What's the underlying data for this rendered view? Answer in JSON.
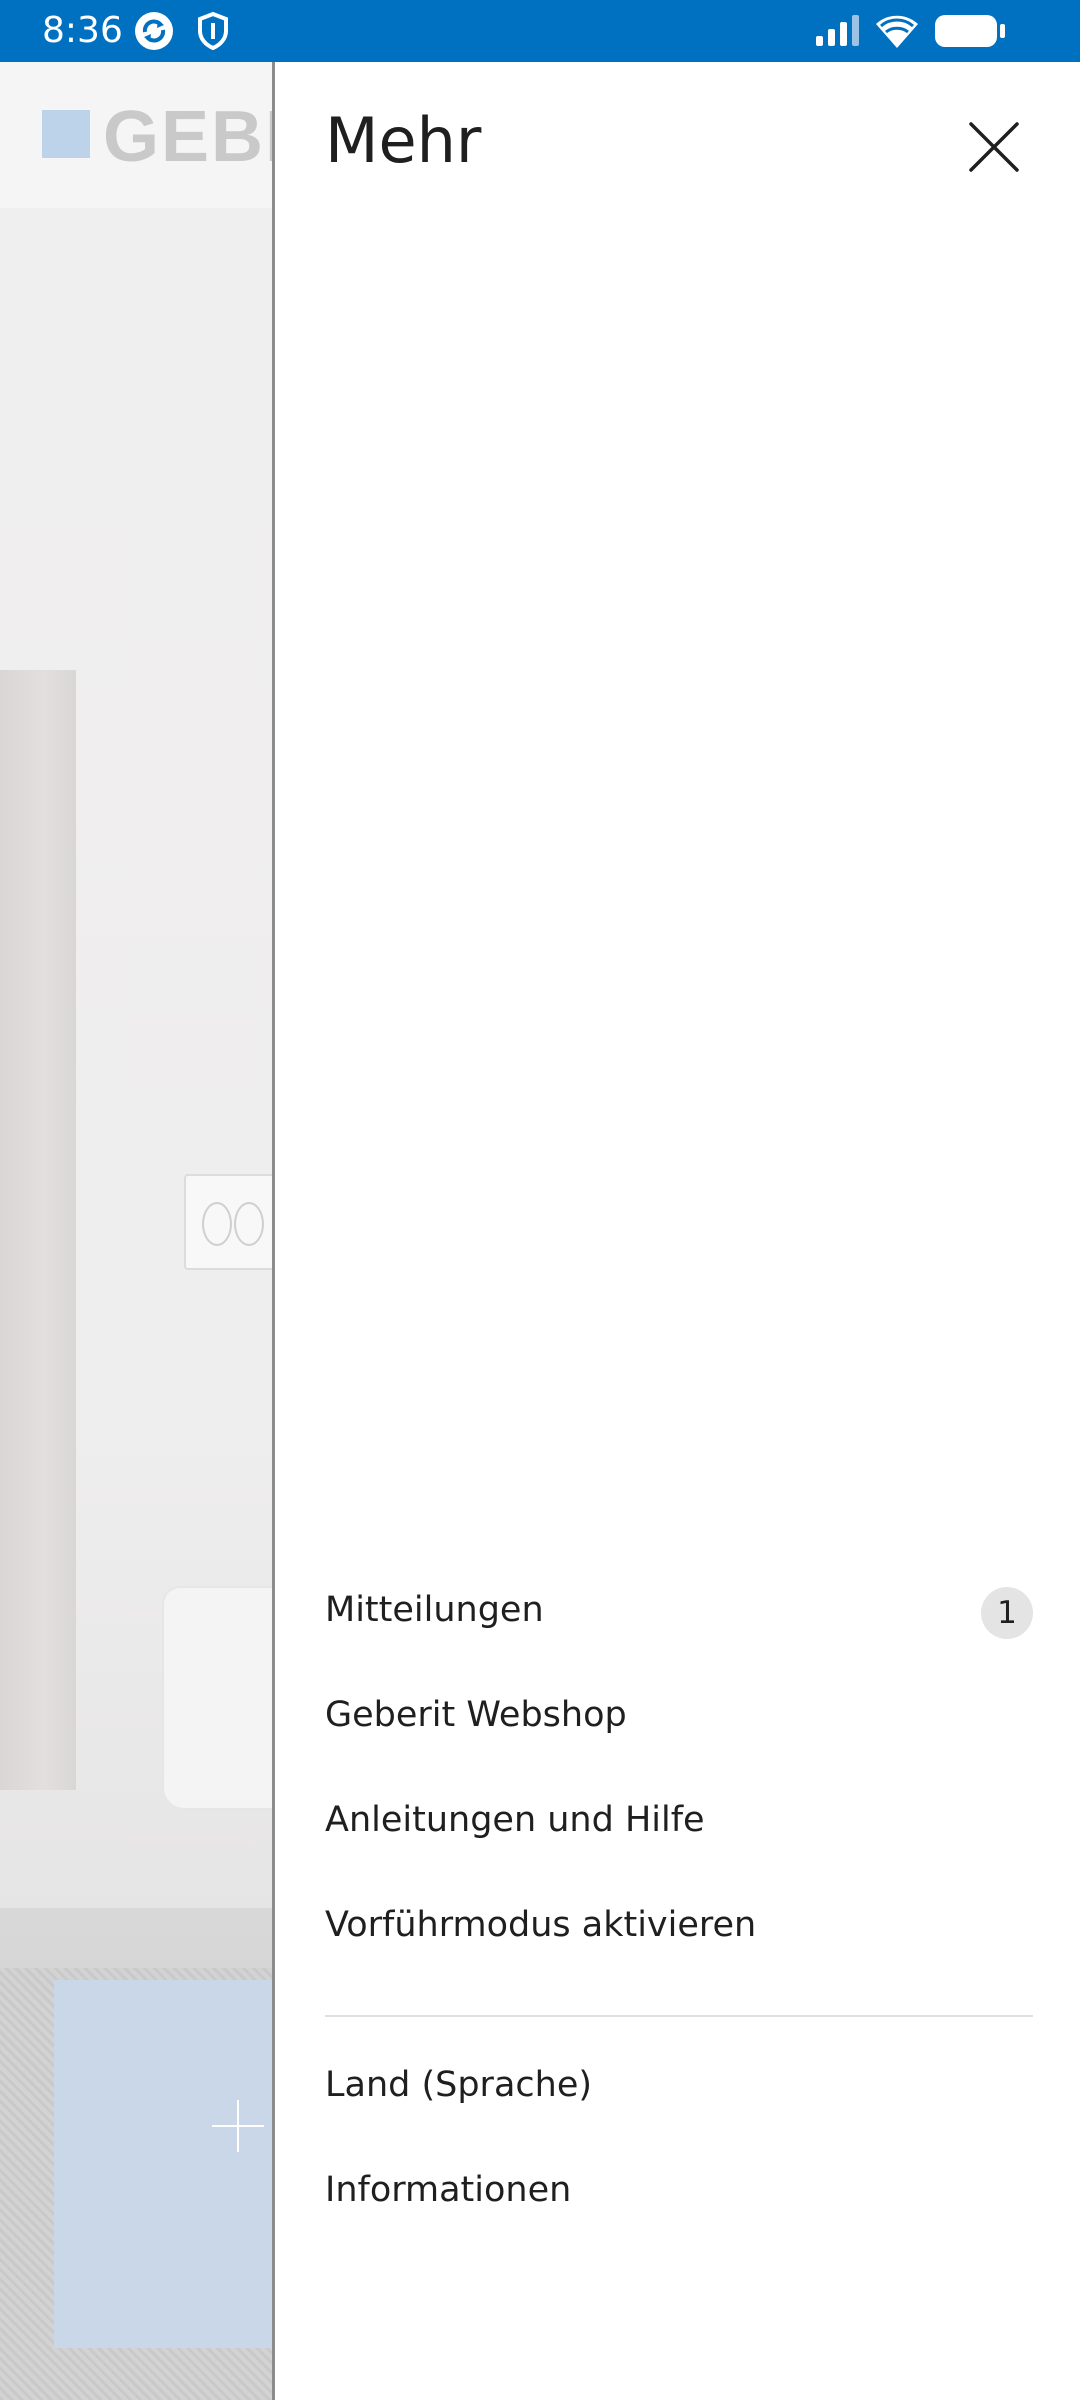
{
  "status_bar": {
    "time": "8:36",
    "background": "#0071c1",
    "left_icons": [
      "sync-icon",
      "shield-icon"
    ],
    "right_icons": [
      "signal-icon",
      "wifi-icon",
      "battery-icon"
    ]
  },
  "background_app": {
    "logo_text": "GEBERIT",
    "brand_color": "#bcd3ea"
  },
  "drawer": {
    "title": "Mehr",
    "close_icon": "close-icon",
    "menu_items": [
      {
        "label": "Mitteilungen",
        "badge": "1"
      },
      {
        "label": "Geberit Webshop"
      },
      {
        "label": "Anleitungen und Hilfe"
      },
      {
        "label": "Vorführmodus aktivieren"
      },
      {
        "label": "Land (Sprache)"
      },
      {
        "label": "Informationen"
      }
    ]
  }
}
